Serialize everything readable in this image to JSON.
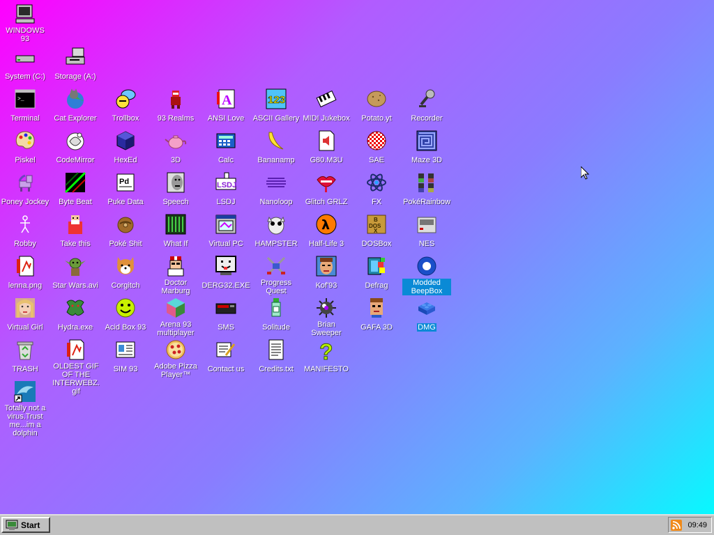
{
  "desktop": {
    "icons": {
      "windows93": "WINDOWS 93",
      "system_c": "System (C:)",
      "storage_a": "Storage (A:)",
      "terminal": "Terminal",
      "cat_explorer": "Cat Explorer",
      "trollbox": "Trollbox",
      "realms93": "93 Realms",
      "ansi_love": "ANSI Love",
      "ascii_gallery": "ASCII Gallery",
      "midi_jukebox": "MIDI Jukebox",
      "potato_yt": "Potato.yt",
      "recorder": "Recorder",
      "piskel": "Piskel",
      "codemirror": "CodeMirror",
      "hexed": "HexEd",
      "3d": "3D",
      "calc": "Calc",
      "bananamp": "Bananamp",
      "g80m3u": "G80.M3U",
      "sae": "SAE",
      "maze3d": "Maze 3D",
      "poney_jockey": "Poney Jockey",
      "byte_beat": "Byte Beat",
      "puke_data": "Puke Data",
      "speech": "Speech",
      "lsdj": "LSDJ",
      "nanoloop": "Nanoloop",
      "glitch_grlz": "Glitch GRLZ",
      "fx": "FX",
      "pokerainbow": "PokéRainbow",
      "robby": "Robby",
      "take_this": "Take this",
      "pokemon_shit": "Poké Shit",
      "what_if": "What If",
      "virtual_pc": "Virtual PC",
      "hampster": "HAMPSTER",
      "half_life_3": "Half-Life 3",
      "dosbox": "DOSBox",
      "nes": "NES",
      "lenna": "lenna.png",
      "star_wars": "Star Wars.avi",
      "corgitch": "Corgitch",
      "doctor_marburg": "Doctor Marburg",
      "derg32": "DERG32.EXE",
      "progress_quest": "Progress Quest",
      "kof93": "Kof'93",
      "defrag": "Defrag",
      "modded_beepbox": "Modded BeepBox",
      "virtual_girl": "Virtual Girl",
      "hydra": "Hydra.exe",
      "acid_box": "Acid Box 93",
      "arena93": "Arena 93 multiplayer",
      "sms": "SMS",
      "solitude": "Solitude",
      "brian_sweeper": "Brian Sweeper",
      "gafa3d": "GAFA 3D",
      "dmg": "DMG",
      "trash": "TRASH",
      "oldest_gif": "OLDEST GIF OF THE INTERWEBZ.gif",
      "sim93": "SIM 93",
      "adobe_pizza": "Adobe Pizza Player™",
      "contact_us": "Contact us",
      "credits": "Credits.txt",
      "manifesto": "MANIFESTO",
      "dolphin": "Totally not a virus.Trust me...im a dolphin"
    }
  },
  "taskbar": {
    "start_label": "Start",
    "clock": "09:49"
  },
  "colors": {
    "selection": "#0a8ad6",
    "taskbar": "#c0c0c0",
    "gradient_start": "#ff00ff",
    "gradient_end": "#00ffff"
  }
}
